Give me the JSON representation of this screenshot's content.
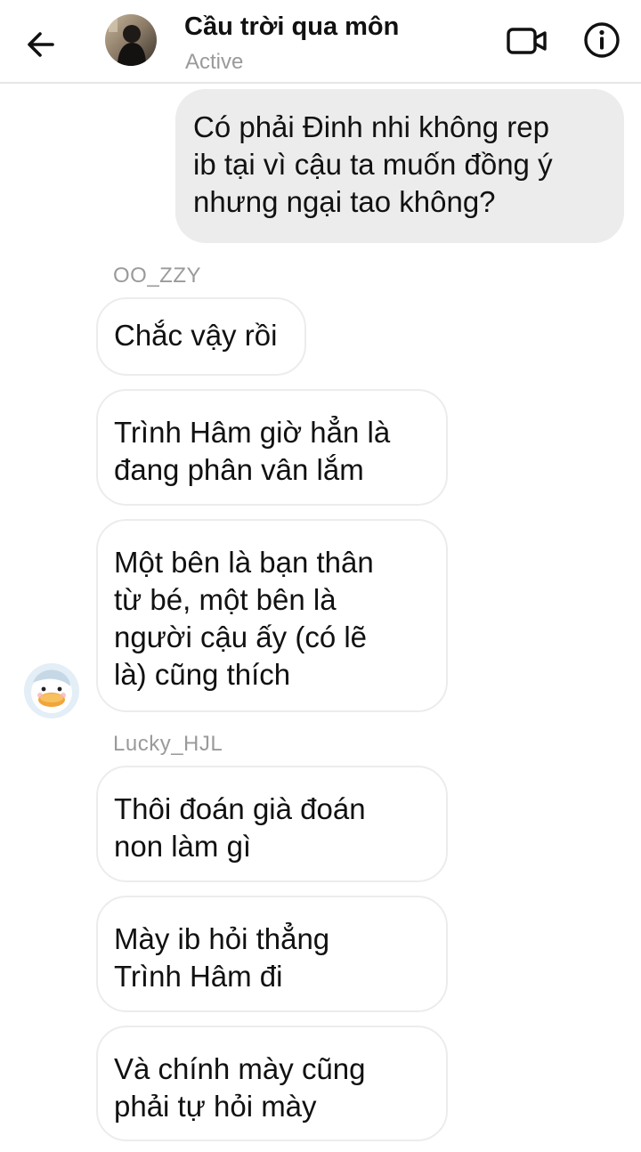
{
  "header": {
    "title": "Cầu trời qua môn",
    "status": "Active",
    "icons": {
      "back": "arrow-left-icon",
      "video": "video-camera-icon",
      "info": "info-icon"
    }
  },
  "messages": {
    "outgoing": [
      {
        "text": "Có phải Đinh nhi không rep\nib tại vì cậu ta muốn đồng ý\nnhưng ngại tao không?"
      }
    ],
    "group1": {
      "sender": "OO_ZZY",
      "items": [
        {
          "text": "Chắc vậy rồi"
        },
        {
          "text": "Trình Hâm giờ hẳn là\nđang phân vân lắm"
        },
        {
          "text": "Một bên là bạn thân\ntừ bé, một bên là\nngười cậu ấy (có lẽ\nlà) cũng thích"
        }
      ]
    },
    "group2": {
      "sender": "Lucky_HJL",
      "items": [
        {
          "text": "Thôi đoán già đoán\nnon làm gì"
        },
        {
          "text": "Mày ib hỏi thẳng\nTrình Hâm đi"
        },
        {
          "text": "Và chính mày cũng\nphải tự hỏi mày"
        }
      ]
    }
  },
  "colors": {
    "outgoing_bubble": "#ececec",
    "incoming_border": "#ececec",
    "muted_text": "#9a9a9a"
  }
}
